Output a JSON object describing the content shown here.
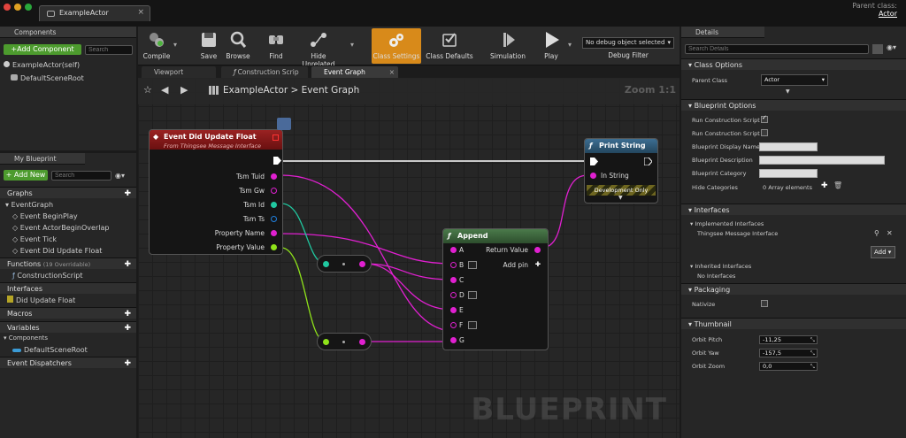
{
  "titlebar": {
    "tab": "ExampleActor",
    "parent_class_label": "Parent class:",
    "parent_class_value": "Actor"
  },
  "components": {
    "header": "Components",
    "add_button": "+Add Component",
    "search_placeholder": "Search",
    "items": [
      "ExampleActor(self)",
      "DefaultSceneRoot"
    ]
  },
  "my_blueprint": {
    "header": "My Blueprint",
    "add_button": "+ Add New",
    "search_placeholder": "Search",
    "graphs_label": "Graphs",
    "event_graph": "EventGraph",
    "events": [
      "Event BeginPlay",
      "Event ActorBeginOverlap",
      "Event Tick",
      "Event Did Update Float"
    ],
    "functions_label": "Functions",
    "functions_count": "(19 Overridable)",
    "construction_script": "ConstructionScript",
    "interfaces_label": "Interfaces",
    "interface_item": "Did Update Float",
    "macros_label": "Macros",
    "variables_label": "Variables",
    "components_label": "Components",
    "default_scene_root": "DefaultSceneRoot",
    "dispatchers_label": "Event Dispatchers"
  },
  "toolbar": {
    "compile": "Compile",
    "save": "Save",
    "browse": "Browse",
    "find": "Find",
    "hide_unrelated": "Hide Unrelated",
    "class_settings": "Class Settings",
    "class_defaults": "Class Defaults",
    "simulation": "Simulation",
    "play": "Play",
    "debug_object": "No debug object selected",
    "debug_filter": "Debug Filter"
  },
  "doc_tabs": [
    "Viewport",
    "Construction Scrip",
    "Event Graph"
  ],
  "graph": {
    "breadcrumb_root": "ExampleActor",
    "breadcrumb_page": "Event Graph",
    "zoom": "Zoom 1:1",
    "watermark": "BLUEPRINT",
    "event_node": {
      "title": "Event Did Update Float",
      "subtitle": "From Thingsee Message Interface",
      "pins": [
        "Tsm Tuid",
        "Tsm Gw",
        "Tsm Id",
        "Tsm Ts",
        "Property Name",
        "Property Value"
      ]
    },
    "print_node": {
      "title": "Print String",
      "in_string": "In String",
      "dev_only": "Development Only"
    },
    "append_node": {
      "title": "Append",
      "return_value": "Return Value",
      "add_pin": "Add pin",
      "inputs": [
        "A",
        "B",
        "C",
        "D",
        "E",
        "F",
        "G"
      ]
    }
  },
  "details": {
    "header": "Details",
    "search_placeholder": "Search Details",
    "class_options": "Class Options",
    "parent_class_label": "Parent Class",
    "parent_class_value": "Actor",
    "blueprint_options": "Blueprint Options",
    "run_cs_1": "Run Construction Script o",
    "run_cs_2": "Run Construction Script w",
    "bp_display_name": "Blueprint Display Name",
    "bp_description": "Blueprint Description",
    "bp_category": "Blueprint Category",
    "hide_categories": "Hide Categories",
    "hide_categories_value": "0 Array elements",
    "interfaces": "Interfaces",
    "implemented_interfaces": "Implemented Interfaces",
    "thingsee_interface": "Thingsee Message Interface",
    "add_button": "Add",
    "inherited_interfaces": "Inherited Interfaces",
    "no_interfaces": "No Interfaces",
    "packaging": "Packaging",
    "nativize": "Nativize",
    "thumbnail": "Thumbnail",
    "orbit_pitch_label": "Orbit Pitch",
    "orbit_pitch": "-11,25",
    "orbit_yaw_label": "Orbit Yaw",
    "orbit_yaw": "-157,5",
    "orbit_zoom_label": "Orbit Zoom",
    "orbit_zoom": "0,0"
  },
  "colors": {
    "accent_orange": "#d88a1a",
    "event_red": "#8a1c1c",
    "function_blue": "#2f5b7a",
    "append_green": "#3d6b3d",
    "string_pin": "#e020d0",
    "float_pin": "#8fe31a",
    "int_pin": "#20c8a0"
  }
}
